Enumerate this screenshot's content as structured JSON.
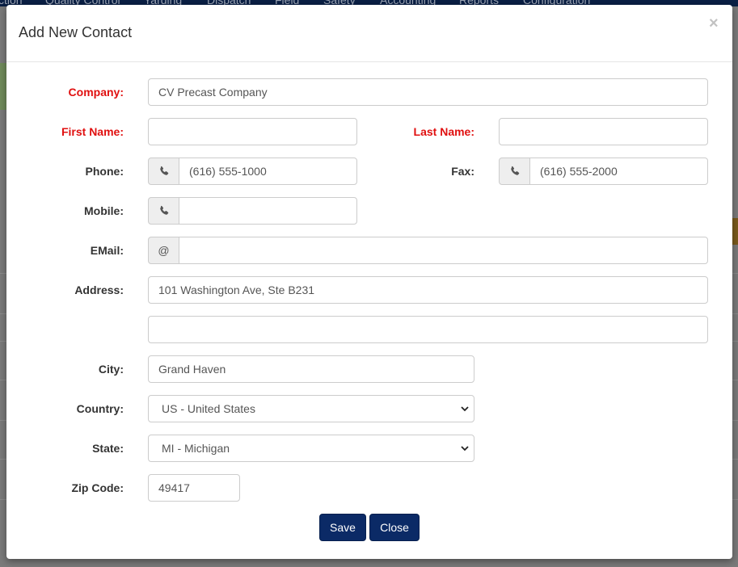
{
  "background": {
    "nav_items": [
      "ction",
      "Quality Control",
      "Yarding",
      "Dispatch",
      "Field",
      "Safety",
      "Accounting",
      "Reports",
      "Configuration"
    ]
  },
  "modal": {
    "title": "Add New Contact",
    "close_symbol": "×",
    "fields": {
      "company": {
        "label": "Company:",
        "value": "CV Precast Company"
      },
      "first_name": {
        "label": "First Name:",
        "value": ""
      },
      "last_name": {
        "label": "Last Name:",
        "value": ""
      },
      "phone": {
        "label": "Phone:",
        "value": "(616) 555-1000",
        "icon": "phone-icon"
      },
      "fax": {
        "label": "Fax:",
        "value": "(616) 555-2000",
        "icon": "phone-icon"
      },
      "mobile": {
        "label": "Mobile:",
        "value": "",
        "icon": "phone-icon"
      },
      "email": {
        "label": "EMail:",
        "value": "",
        "addon": "@"
      },
      "address": {
        "label": "Address:",
        "value": "101 Washington Ave, Ste B231",
        "value2": ""
      },
      "city": {
        "label": "City:",
        "value": "Grand Haven"
      },
      "country": {
        "label": "Country:",
        "value": "US - United States"
      },
      "state": {
        "label": "State:",
        "value": "MI - Michigan"
      },
      "zip": {
        "label": "Zip Code:",
        "value": "49417"
      }
    },
    "buttons": {
      "save": "Save",
      "close": "Close"
    },
    "colors": {
      "required_label": "#e01010",
      "button_bg": "#0b2a66"
    }
  }
}
